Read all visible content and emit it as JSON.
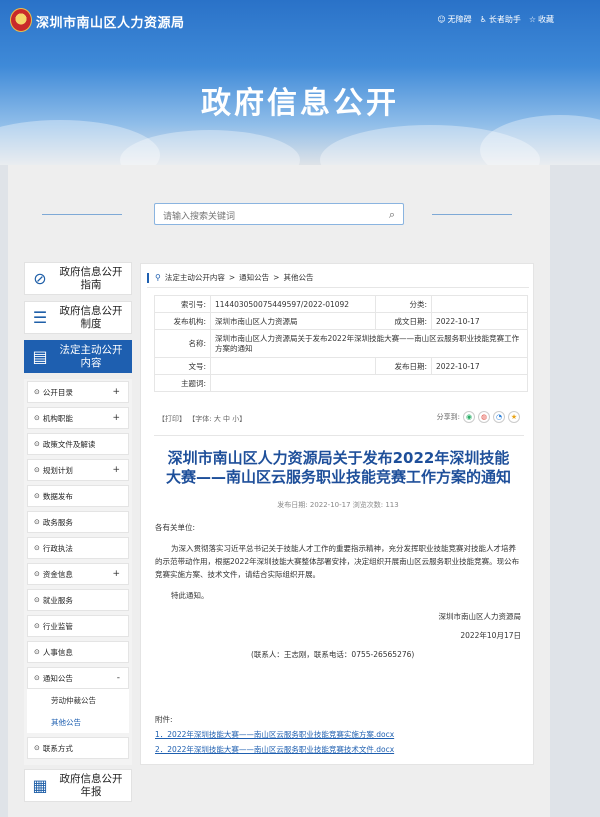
{
  "header": {
    "site_title": "深圳市南山区人力资源局",
    "links": [
      {
        "icon": "accessibility-icon",
        "label": "无障碍"
      },
      {
        "icon": "elder-icon",
        "label": "长者助手"
      },
      {
        "icon": "star-icon",
        "label": "收藏"
      }
    ],
    "banner_title": "政府信息公开"
  },
  "search": {
    "placeholder": "请输入搜索关键词"
  },
  "sidebar": {
    "guide": "政府信息公开指南",
    "system": "政府信息公开制度",
    "statutory": "法定主动公开内容",
    "items": [
      {
        "label": "公开目录",
        "plus": "+"
      },
      {
        "label": "机构职能",
        "plus": "+"
      },
      {
        "label": "政策文件及解读",
        "plus": ""
      },
      {
        "label": "规划计划",
        "plus": "+"
      },
      {
        "label": "数据发布",
        "plus": ""
      },
      {
        "label": "政务服务",
        "plus": ""
      },
      {
        "label": "行政执法",
        "plus": ""
      },
      {
        "label": "资金信息",
        "plus": "+"
      },
      {
        "label": "就业服务",
        "plus": ""
      },
      {
        "label": "行业监管",
        "plus": ""
      },
      {
        "label": "人事信息",
        "plus": ""
      },
      {
        "label": "通知公告",
        "plus": "-"
      }
    ],
    "sub_items": [
      "劳动仲裁公告",
      "其他公告"
    ],
    "contact": "联系方式",
    "annual": "政府信息公开年报"
  },
  "breadcrumb": [
    "法定主动公开内容",
    ">",
    "通知公告",
    ">",
    "其他公告"
  ],
  "meta": {
    "index_label": "索引号:",
    "index_value": "11440305007544959​7/2022-01092",
    "category_label": "分类:",
    "category_value": "",
    "publisher_label": "发布机构:",
    "publisher_value": "深圳市南山区人力资源局",
    "written_label": "成文日期:",
    "written_value": "2022-10-17",
    "name_label": "名称:",
    "name_value": "深圳市南山区人力资源局关于发布2022年深圳技能大赛——南山区云服务职业技能竞赛工作方案的通知",
    "docno_label": "文号:",
    "docno_value": "",
    "pubdate_label": "发布日期:",
    "pubdate_value": "2022-10-17",
    "subject_label": "主题词:",
    "subject_value": ""
  },
  "tools": {
    "print": "【打印】",
    "font": "【字体: 大 中 小】",
    "share": "分享到:"
  },
  "article": {
    "title": "深圳市南山区人力资源局关于发布2022年深圳技能大赛——南山区云服务职业技能竞赛工作方案的通知",
    "date_line": "发布日期: 2022-10-17  浏览次数: 113",
    "salutation": "各有关单位:",
    "para1": "为深入贯彻落实习近平总书记关于技能人才工作的重要指示精神，充分发挥职业技能竞赛对技能人才培养的示范带动作用，根据2022年深圳技能大赛整体部署安排，决定组织开展南山区云服务职业技能竞赛。现公布竞赛实施方案、技术文件，请结合实际组织开展。",
    "para2": "特此通知。",
    "signer": "深圳市南山区人力资源局",
    "sign_date": "2022年10月17日",
    "contact": "(联系人：王志刚，联系电话：0755-26565276)",
    "attach_label": "附件:",
    "attachments": [
      "1．2022年深圳技能大赛——南山区云服务职业技能竞赛实施方案.docx",
      "2．2022年深圳技能大赛——南山区云服务职业技能竞赛技术文件.docx"
    ]
  }
}
